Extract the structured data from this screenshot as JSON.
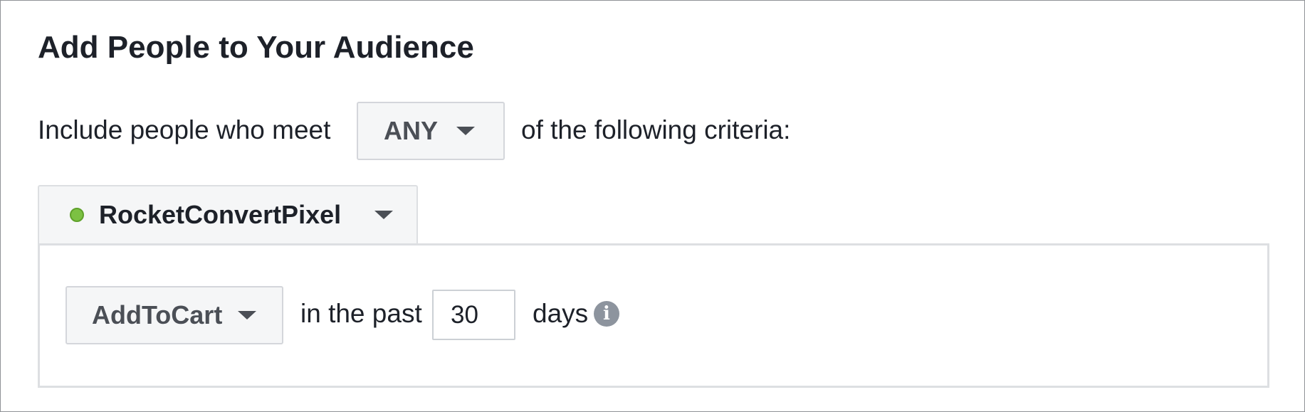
{
  "panel": {
    "title": "Add People to Your Audience"
  },
  "criteria": {
    "prefix": "Include people who meet",
    "match_selected": "ANY",
    "suffix": "of the following criteria:"
  },
  "source": {
    "pixel_name": "RocketConvertPixel",
    "status": "active",
    "status_color": "#7cc143"
  },
  "rule": {
    "event_selected": "AddToCart",
    "in_the_past_label": "in the past",
    "days_value": "30",
    "days_label": "days",
    "info_icon": "info-icon"
  }
}
